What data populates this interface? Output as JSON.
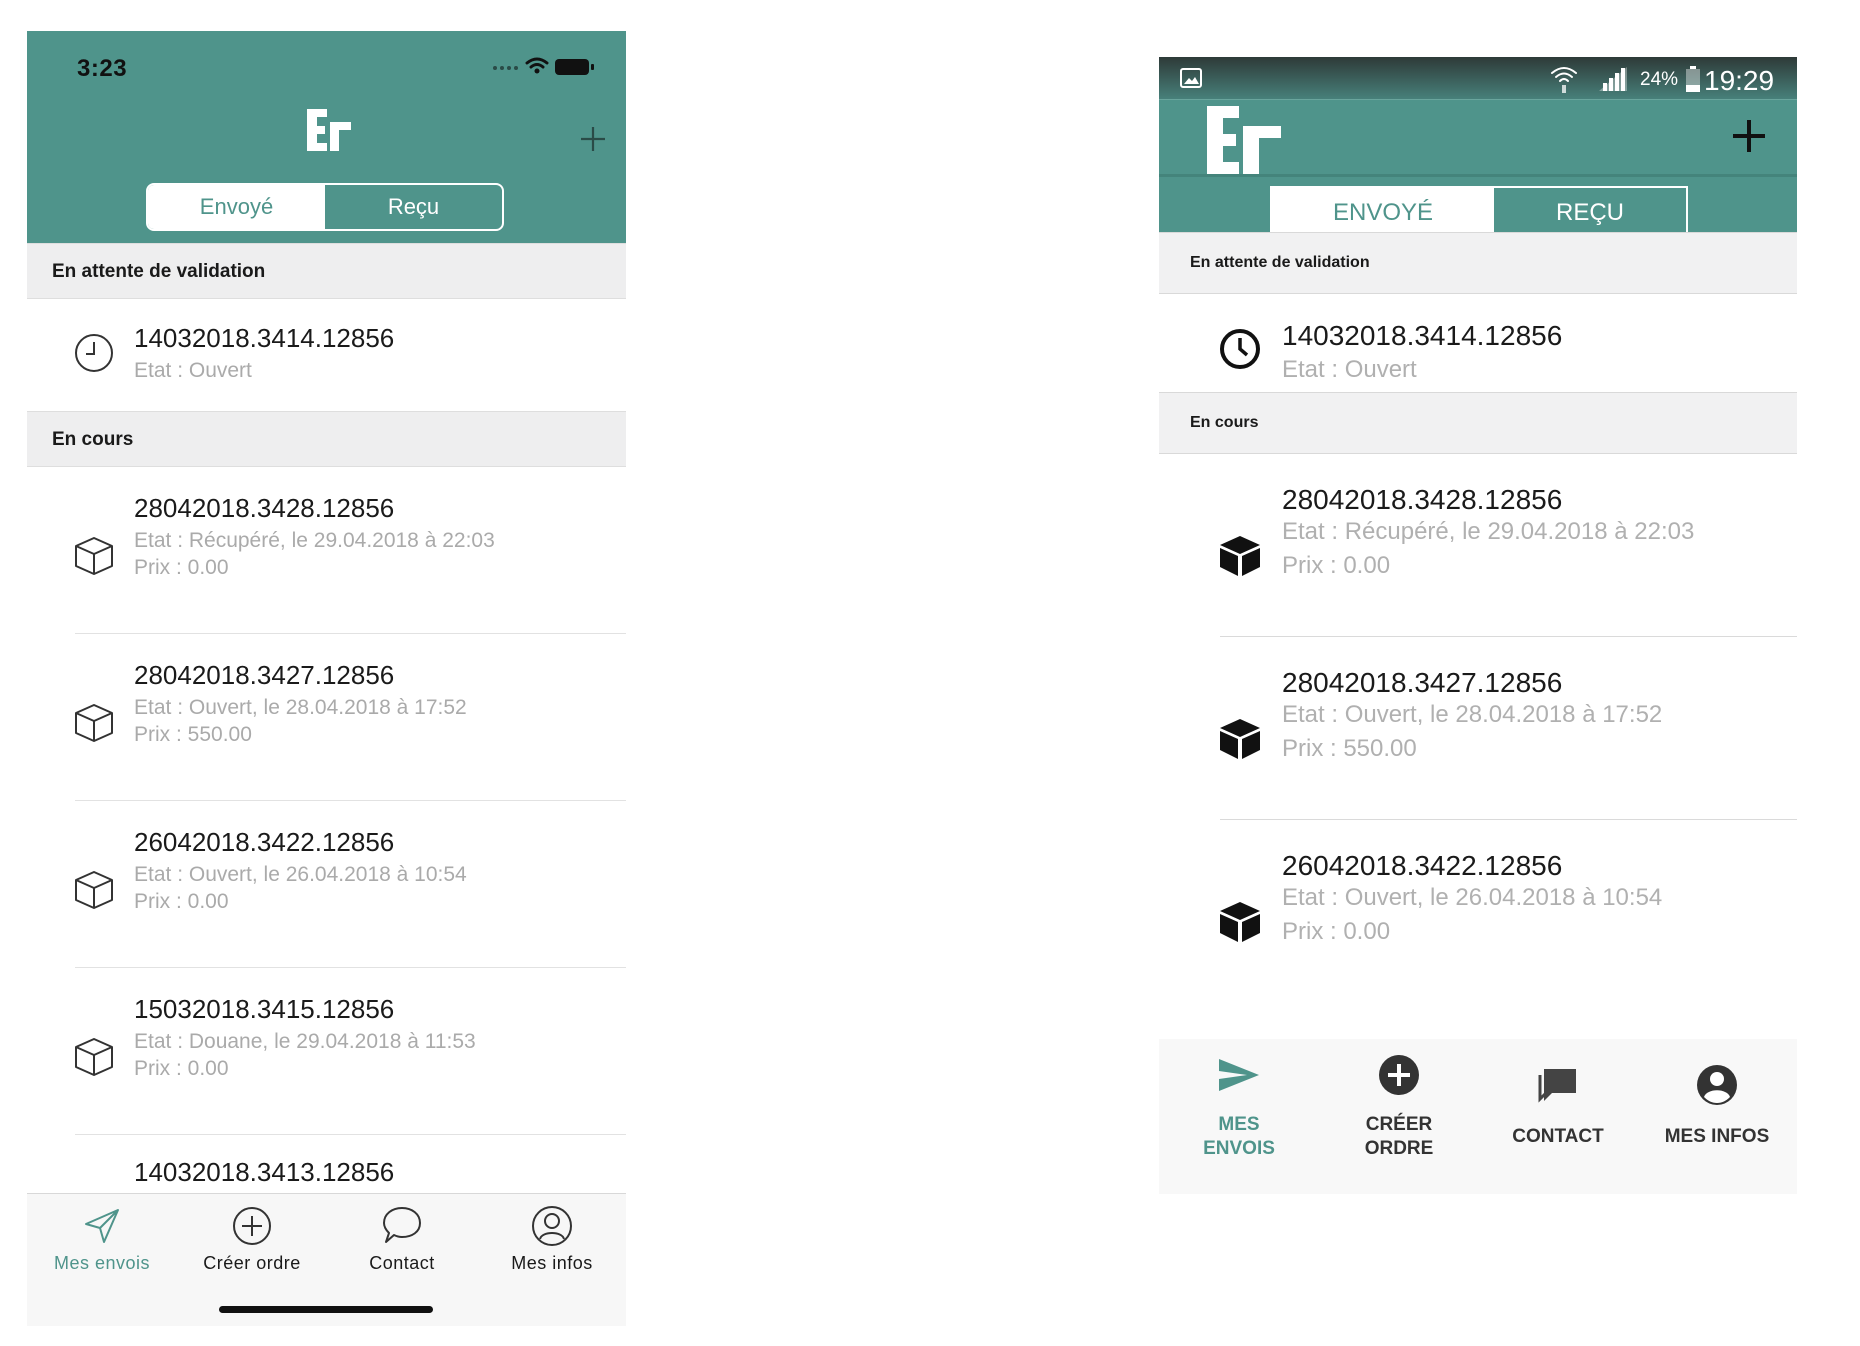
{
  "ios": {
    "status": {
      "time": "3:23"
    },
    "tabs": {
      "sent": "Envoyé",
      "received": "Reçu"
    },
    "sections": {
      "pending": "En attente de validation",
      "in_progress": "En cours"
    },
    "pending_items": [
      {
        "id": "14032018.3414.12856",
        "state": "Etat : Ouvert"
      }
    ],
    "items": [
      {
        "id": "28042018.3428.12856",
        "state": "Etat : Récupéré, le 29.04.2018 à 22:03",
        "price": "Prix : 0.00"
      },
      {
        "id": "28042018.3427.12856",
        "state": "Etat : Ouvert, le 28.04.2018 à 17:52",
        "price": "Prix : 550.00"
      },
      {
        "id": "26042018.3422.12856",
        "state": "Etat : Ouvert, le 26.04.2018 à 10:54",
        "price": "Prix : 0.00"
      },
      {
        "id": "15032018.3415.12856",
        "state": "Etat : Douane, le 29.04.2018 à 11:53",
        "price": "Prix : 0.00"
      },
      {
        "id": "14032018.3413.12856"
      }
    ],
    "tabbar": [
      {
        "label": "Mes envois",
        "icon": "send-icon"
      },
      {
        "label": "Créer ordre",
        "icon": "add-circle-icon"
      },
      {
        "label": "Contact",
        "icon": "chat-icon"
      },
      {
        "label": "Mes infos",
        "icon": "user-icon"
      }
    ]
  },
  "android": {
    "status": {
      "battery": "24%",
      "time": "19:29"
    },
    "tabs": {
      "sent": "ENVOYÉ",
      "received": "REÇU"
    },
    "sections": {
      "pending": "En attente de validation",
      "in_progress": "En cours"
    },
    "pending_items": [
      {
        "id": "14032018.3414.12856",
        "state": "Etat : Ouvert"
      }
    ],
    "items": [
      {
        "id": "28042018.3428.12856",
        "state": "Etat : Récupéré, le 29.04.2018 à 22:03",
        "price": "Prix : 0.00"
      },
      {
        "id": "28042018.3427.12856",
        "state": "Etat : Ouvert, le 28.04.2018 à 17:52",
        "price": "Prix : 550.00"
      },
      {
        "id": "26042018.3422.12856",
        "state": "Etat : Ouvert, le 26.04.2018 à 10:54",
        "price": "Prix : 0.00"
      }
    ],
    "nav": [
      {
        "label_line1": "MES",
        "label_line2": "ENVOIS",
        "icon": "send-icon"
      },
      {
        "label_line1": "CRÉER",
        "label_line2": "ORDRE",
        "icon": "add-circle-icon"
      },
      {
        "label": "CONTACT",
        "icon": "chat-icon"
      },
      {
        "label": "MES INFOS",
        "icon": "account-icon"
      }
    ]
  },
  "colors": {
    "brand": "#4f948b",
    "section_bg": "#eeeeef",
    "muted_text": "#aaaaaa"
  }
}
